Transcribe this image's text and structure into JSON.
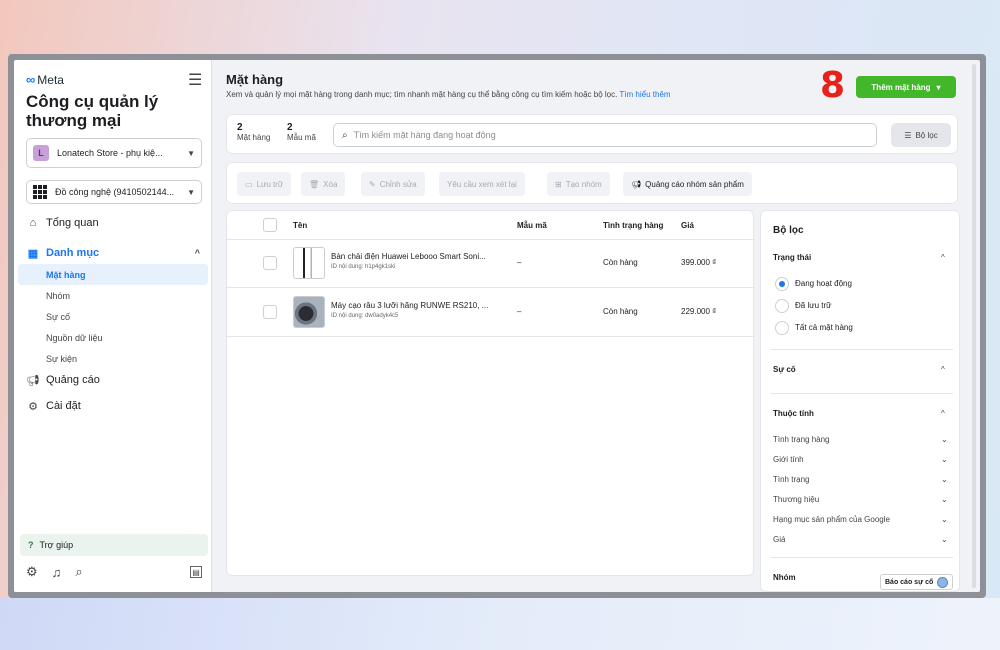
{
  "sidebar": {
    "brand": "Meta",
    "title": "Công cụ quản lý thương mại",
    "store_select": "Lonatech Store - phụ kiệ...",
    "store_avatar": "L",
    "business_select": "Đồ công nghệ (9410502144...",
    "nav": {
      "overview": "Tổng quan",
      "catalog": "Danh mục",
      "items": "Mặt hàng",
      "groups": "Nhóm",
      "issues": "Sự cố",
      "data_sources": "Nguồn dữ liệu",
      "events": "Sự kiện",
      "ads": "Quảng cáo",
      "settings": "Cài đặt"
    },
    "help": "Trợ giúp"
  },
  "header": {
    "title": "Mặt hàng",
    "description": "Xem và quản lý mọi mặt hàng trong danh mục; tìm nhanh mặt hàng cụ thể bằng công cụ tìm kiếm hoặc bộ lọc.",
    "learn_more": "Tìm hiểu thêm",
    "annotation": "8",
    "add_button": "Thêm mặt hàng"
  },
  "search": {
    "items_count": "2",
    "items_label": "Mặt hàng",
    "variants_count": "2",
    "variants_label": "Mẫu mã",
    "placeholder": "Tìm kiếm mặt hàng đang hoạt động",
    "filter_button": "Bộ lọc"
  },
  "toolbar": {
    "archive": "Lưu trữ",
    "delete": "Xóa",
    "edit": "Chỉnh sửa",
    "request_review": "Yêu cầu xem xét lại",
    "create_group": "Tạo nhóm",
    "advertise": "Quảng cáo nhóm sản phẩm"
  },
  "table": {
    "columns": {
      "name": "Tên",
      "variant": "Mẫu mã",
      "status": "Tình trạng hàng",
      "price": "Giá"
    },
    "rows": [
      {
        "name": "Bàn chải điện Huawei Lebooo Smart Soni...",
        "id": "ID nội dung: h1p4gk1ski",
        "variant": "–",
        "status": "Còn hàng",
        "price": "399.000 ₫"
      },
      {
        "name": "Máy cạo râu 3 lưỡi hãng RUNWE RS210, ...",
        "id": "ID nội dung: dw0adyk4c5",
        "variant": "–",
        "status": "Còn hàng",
        "price": "229.000 ₫"
      }
    ]
  },
  "filters": {
    "title": "Bộ lọc",
    "status_section": "Trạng thái",
    "status_options": [
      "Đang hoạt động",
      "Đã lưu trữ",
      "Tất cả mặt hàng"
    ],
    "issues_section": "Sự cố",
    "attributes_section": "Thuộc tính",
    "attributes": [
      "Tình trạng hàng",
      "Giới tính",
      "Tình trạng",
      "Thương hiệu",
      "Hạng mục sản phẩm của Google",
      "Giá"
    ],
    "groups_section": "Nhóm"
  },
  "report_button": "Báo cáo sự cố"
}
